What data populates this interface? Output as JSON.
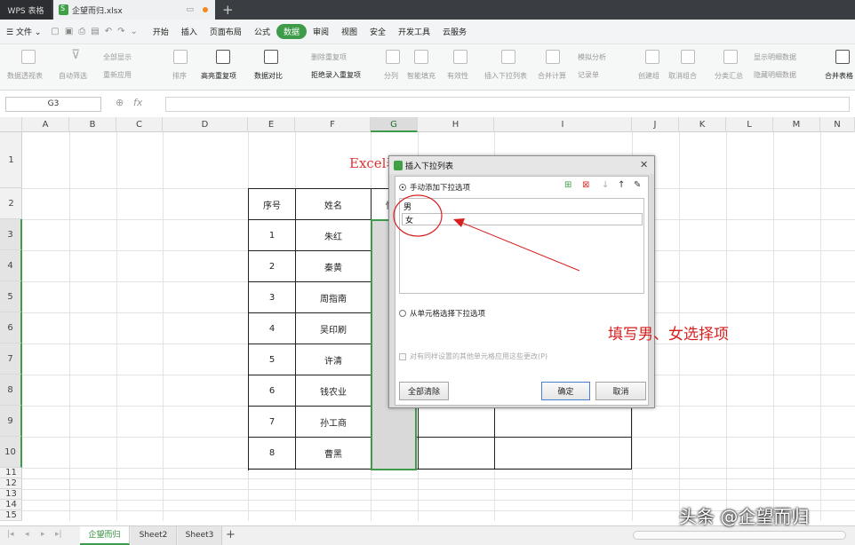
{
  "window": {
    "app_tab": "WPS 表格",
    "file_tab": "企望而归.xlsx"
  },
  "menu": {
    "file": "文件",
    "items": [
      "开始",
      "插入",
      "页面布局",
      "公式",
      "数据",
      "审阅",
      "视图",
      "安全",
      "开发工具",
      "云服务"
    ],
    "active": "数据"
  },
  "ribbon": {
    "pivot": "数据透视表",
    "autofilter": "自动筛选",
    "show_all": "全部显示",
    "reapply": "重新应用",
    "sort": "排序",
    "highlight_dup": "高亮重复项",
    "compare": "数据对比",
    "remove_dup": "删除重复项",
    "reject_dup": "拒绝录入重复项",
    "split": "分列",
    "smart_fill": "智能填充",
    "validity": "有效性",
    "insert_dropdown": "插入下拉列表",
    "consolidate": "合并计算",
    "simulate": "模拟分析",
    "record": "记录单",
    "group": "创建组",
    "ungroup": "取消组合",
    "subtotal": "分类汇总",
    "show_detail": "显示明细数据",
    "hide_detail": "隐藏明细数据",
    "merge_tables": "合并表格"
  },
  "formula_bar": {
    "name_box": "G3",
    "fx": "fx"
  },
  "columns": [
    "A",
    "B",
    "C",
    "D",
    "E",
    "F",
    "G",
    "H",
    "I",
    "J",
    "K",
    "L",
    "M",
    "N"
  ],
  "rows": [
    "1",
    "2",
    "3",
    "4",
    "5",
    "6",
    "7",
    "8",
    "9",
    "10",
    "11",
    "12",
    "13",
    "14",
    "15"
  ],
  "sheet": {
    "title": "Excel表格制作下拉菜单",
    "headers": [
      "序号",
      "姓名",
      "性别"
    ],
    "data": [
      {
        "no": "1",
        "name": "朱红"
      },
      {
        "no": "2",
        "name": "秦黄"
      },
      {
        "no": "3",
        "name": "周指南"
      },
      {
        "no": "4",
        "name": "吴印刷"
      },
      {
        "no": "5",
        "name": "许清"
      },
      {
        "no": "6",
        "name": "钱农业"
      },
      {
        "no": "7",
        "name": "孙工商"
      },
      {
        "no": "8",
        "name": "曹黑"
      }
    ]
  },
  "dialog": {
    "title": "插入下拉列表",
    "manual_option": "手动添加下拉选项",
    "options": [
      "男",
      "女"
    ],
    "from_cells_option": "从单元格选择下拉选项",
    "apply_same": "对有同样设置的其他单元格应用这些更改(P)",
    "clear_all": "全部清除",
    "ok": "确定",
    "cancel": "取消"
  },
  "annotation": "填写男、女选择项",
  "sheet_tabs": [
    "企望而归",
    "Sheet2",
    "Sheet3"
  ],
  "watermark": "头条 @企望而归",
  "colors": {
    "accent": "#3e9b4a",
    "annotation": "#d62020"
  }
}
